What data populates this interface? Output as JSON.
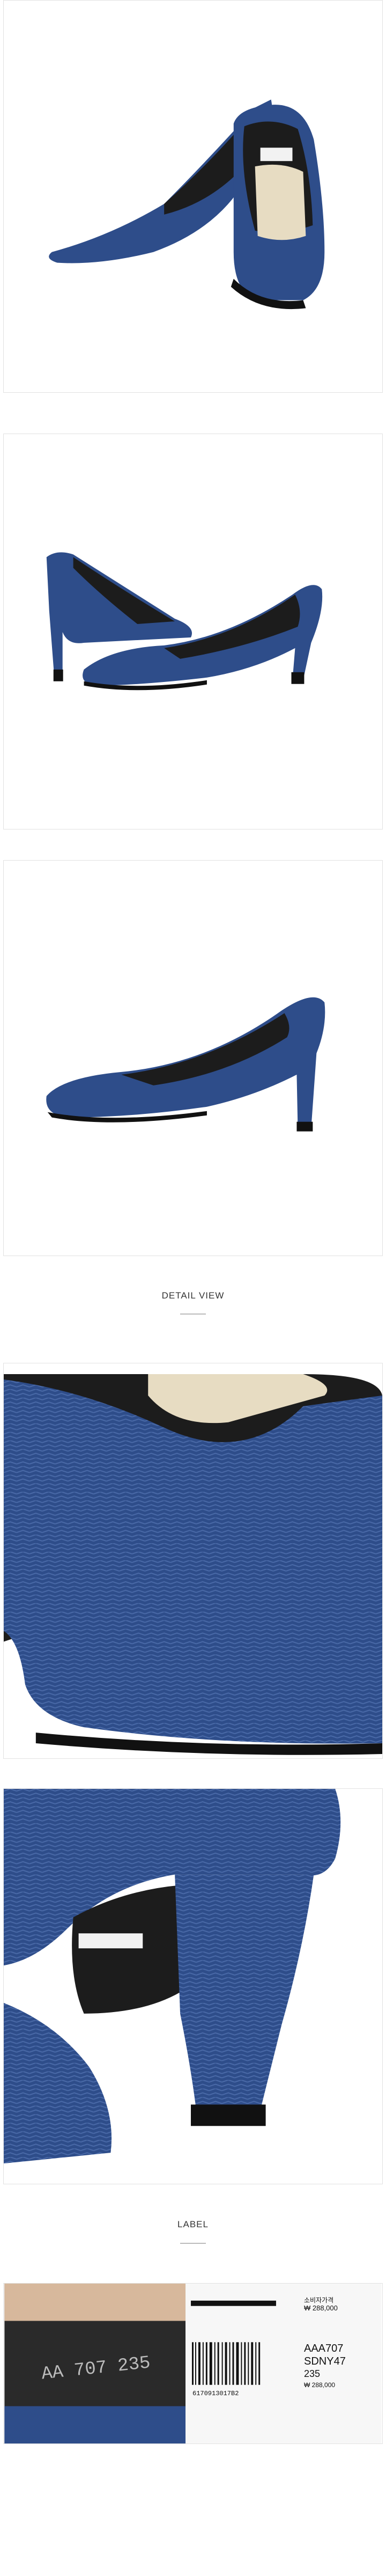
{
  "sections": {
    "detail_view": {
      "title": "DETAIL VIEW"
    },
    "label": {
      "title": "LABEL"
    }
  },
  "label_sticker": {
    "price_label": "소비자가격",
    "price": "₩ 288,000",
    "model": "AAA707",
    "code": "SDNY47",
    "size": "235",
    "price_small": "₩ 288,000",
    "barcode_number": "6170913017B2"
  },
  "insole_imprint": "AA 707 235",
  "colors": {
    "leather_blue": "#2e4d8a",
    "lining_black": "#1c1c1c",
    "background": "#ffffff"
  }
}
